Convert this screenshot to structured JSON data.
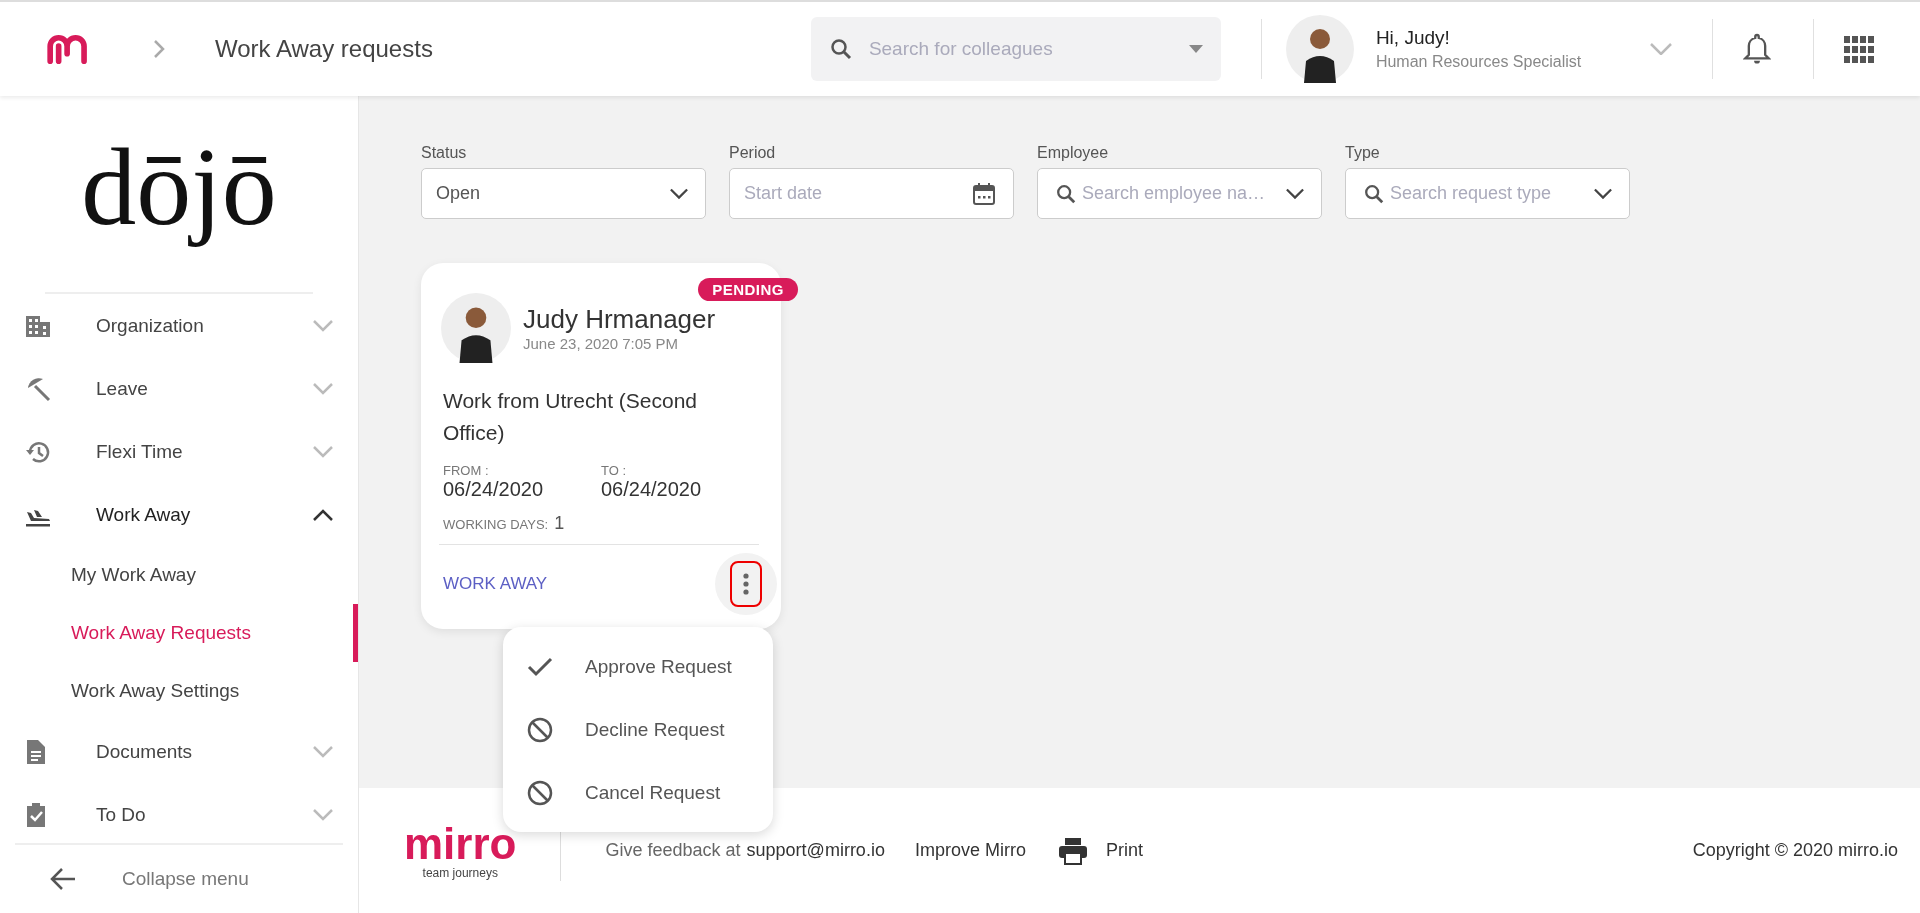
{
  "header": {
    "page_title": "Work Away requests",
    "search": {
      "placeholder": "Search for colleagues"
    },
    "user": {
      "greeting": "Hi, Judy!",
      "role": "Human Resources Specialist"
    }
  },
  "sidebar": {
    "logo": "dōjō",
    "items": [
      {
        "label": "Organization",
        "expanded": false
      },
      {
        "label": "Leave",
        "expanded": false
      },
      {
        "label": "Flexi Time",
        "expanded": false
      },
      {
        "label": "Work Away",
        "expanded": true,
        "children": [
          {
            "label": "My Work Away",
            "selected": false
          },
          {
            "label": "Work Away Requests",
            "selected": true
          },
          {
            "label": "Work Away Settings",
            "selected": false
          }
        ]
      },
      {
        "label": "Documents",
        "expanded": false
      },
      {
        "label": "To Do",
        "expanded": false
      }
    ],
    "collapse": "Collapse menu"
  },
  "filters": [
    {
      "kind": "select",
      "label": "Status",
      "value": "Open"
    },
    {
      "kind": "date",
      "label": "Period",
      "placeholder": "Start date"
    },
    {
      "kind": "search",
      "label": "Employee",
      "placeholder": "Search employee na…"
    },
    {
      "kind": "search",
      "label": "Type",
      "placeholder": "Search request type"
    }
  ],
  "requests": [
    {
      "status": "PENDING",
      "name": "Judy Hrmanager",
      "submitted": "June 23, 2020 7:05 PM",
      "title": "Work from Utrecht (Second Office)",
      "from_label": "FROM :",
      "from": "06/24/2020",
      "to_label": "TO :",
      "to": "06/24/2020",
      "days_label": "WORKING DAYS:",
      "days": "1",
      "type": "WORK AWAY",
      "menu_open": true,
      "menu": [
        {
          "label": "Approve Request"
        },
        {
          "label": "Decline Request"
        },
        {
          "label": "Cancel Request"
        }
      ]
    }
  ],
  "footer": {
    "brand": "mirro",
    "tagline": "team journeys",
    "feedback": "Give feedback at",
    "email": "support@mirro.io",
    "improve": "Improve Mirro",
    "print": "Print",
    "copyright": "Copyright © 2020 mirro.io"
  }
}
